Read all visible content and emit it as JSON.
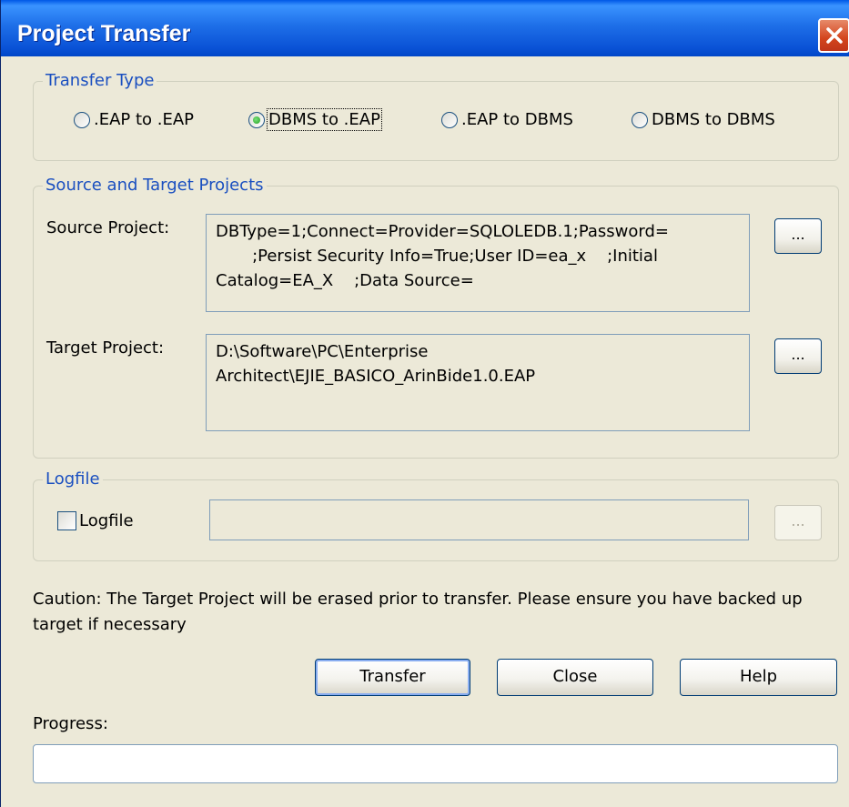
{
  "window": {
    "title": "Project Transfer"
  },
  "transfer_type": {
    "legend": "Transfer Type",
    "options": [
      {
        "label": ".EAP to .EAP",
        "selected": false
      },
      {
        "label": "DBMS to .EAP",
        "selected": true
      },
      {
        "label": ".EAP to DBMS",
        "selected": false
      },
      {
        "label": "DBMS to DBMS",
        "selected": false
      }
    ]
  },
  "projects": {
    "legend": "Source and Target Projects",
    "source_label": "Source Project:",
    "source_value": "DBType=1;Connect=Provider=SQLOLEDB.1;Password=\n       ;Persist Security Info=True;User ID=ea_x    ;Initial\nCatalog=EA_X    ;Data Source=",
    "target_label": "Target Project:",
    "target_value": "D:\\Software\\PC\\Enterprise\nArchitect\\EJIE_BASICO_ArinBide1.0.EAP",
    "browse_label": "..."
  },
  "logfile": {
    "legend": "Logfile",
    "checkbox_label": "Logfile",
    "checked": false,
    "value": "",
    "browse_label": "..."
  },
  "caution": "Caution: The Target Project will be erased prior to transfer. Please ensure you have backed up target if necessary",
  "buttons": {
    "transfer": "Transfer",
    "close": "Close",
    "help": "Help"
  },
  "progress": {
    "label": "Progress:",
    "value": 0
  },
  "colors": {
    "titlebar": "#0a52d6",
    "group_legend": "#1a4fc0",
    "dialog_bg": "#ece9d8"
  }
}
